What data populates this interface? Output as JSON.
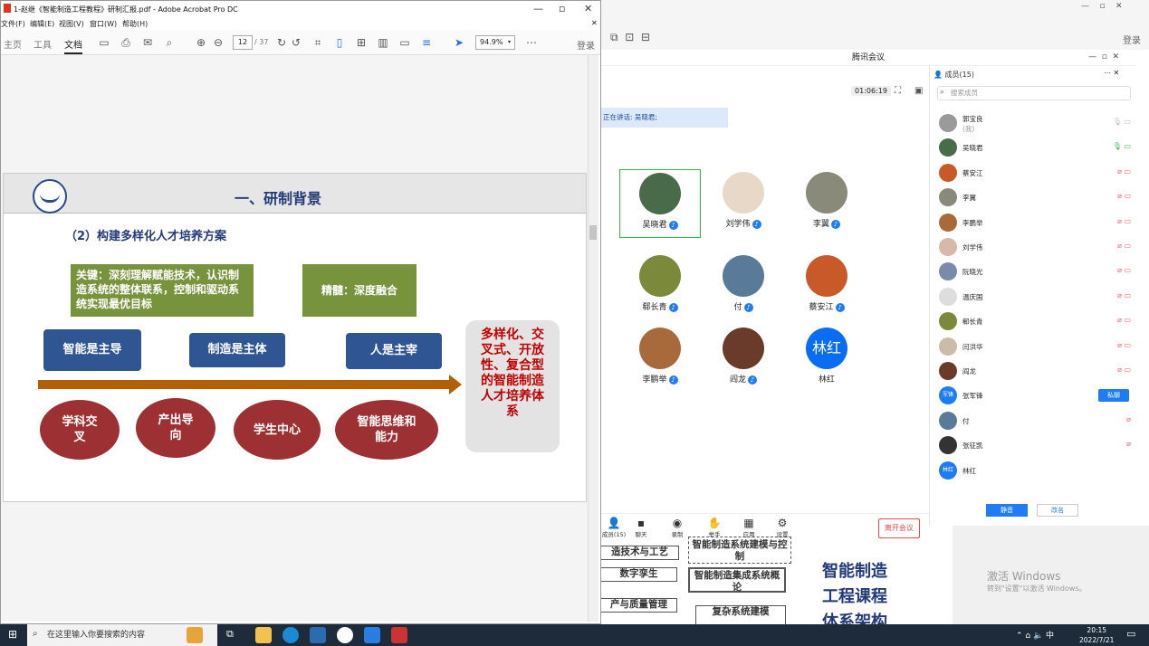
{
  "acrobat": {
    "title": "1-赵继《智能制造工程教程》研制汇报.pdf - Adobe Acrobat Pro DC",
    "menu": [
      "文件(F)",
      "编辑(E)",
      "视图(V)",
      "窗口(W)",
      "帮助(H)"
    ],
    "tabs": [
      "主页",
      "工具",
      "文档"
    ],
    "page_current": "12",
    "page_total": "/ 37",
    "zoom": "94.9%",
    "login": "登录"
  },
  "slide": {
    "heading": "一、研制背景",
    "subheading": "（2）构建多样化人才培养方案",
    "key_box": "关键：深刻理解赋能技术，认识制造系统的整体联系，控制和驱动系统实现最优目标",
    "essence_box": "精髓：深度融合",
    "blue_boxes": [
      "智能是主导",
      "制造是主体",
      "人是主宰"
    ],
    "ovals": [
      "学科交叉",
      "产出导向",
      "学生中心",
      "智能思维和能力"
    ],
    "result": "多样化、交叉式、开放性、复合型的智能制造人才培养体系"
  },
  "meeting": {
    "title": "腾讯会议",
    "timer": "01:06:19",
    "speaking": "正在讲话: 吴晓君;",
    "tiles": [
      {
        "name": "吴晓君",
        "color": "#4a6b4a"
      },
      {
        "name": "刘学伟",
        "color": "#e8d8c8"
      },
      {
        "name": "李翼",
        "color": "#8a8a7a"
      },
      {
        "name": "郗长青",
        "color": "#7a8a3a"
      },
      {
        "name": "付",
        "color": "#5a7a9a"
      },
      {
        "name": "蔡安江",
        "color": "#c85a2a"
      },
      {
        "name": "李鹏举",
        "color": "#a86a3a"
      },
      {
        "name": "阎龙",
        "color": "#6a3a2a"
      },
      {
        "name": "林红",
        "color": "#0a6cf2"
      }
    ],
    "toolbar": [
      "成员(15)",
      "聊天",
      "录制",
      "举手",
      "应用",
      "设置"
    ],
    "leave": "离开会议",
    "members_header": "成员(15)",
    "search_placeholder": "搜索成员",
    "members": [
      {
        "name": "郭宝良",
        "sub": "(我)",
        "color": "#9a9a9a"
      },
      {
        "name": "吴晓君",
        "color": "#4a6b4a"
      },
      {
        "name": "蔡安江",
        "color": "#c85a2a"
      },
      {
        "name": "李翼",
        "color": "#8a8a7a"
      },
      {
        "name": "李鹏举",
        "color": "#a86a3a"
      },
      {
        "name": "刘学伟",
        "color": "#d8b8a8"
      },
      {
        "name": "阮晓光",
        "color": "#7a8aaa"
      },
      {
        "name": "温庆国",
        "color": "#dddddd"
      },
      {
        "name": "郗长青",
        "color": "#7a8a3a"
      },
      {
        "name": "闫洪华",
        "color": "#cbbba8"
      },
      {
        "name": "阎龙",
        "color": "#6a3a2a"
      },
      {
        "name": "张军锋",
        "short": "军锋",
        "color": "#1e7df5"
      },
      {
        "name": "付",
        "color": "#5a7a9a"
      },
      {
        "name": "张征凯",
        "color": "#333333"
      },
      {
        "name": "林红",
        "short": "林红",
        "color": "#1e7df5"
      }
    ],
    "private_chat": "私聊",
    "mute_all": "静音",
    "rename": "改名"
  },
  "background": {
    "login": "登录",
    "boxes": [
      "造技术与工艺",
      "智能制造系统建模与控制",
      "数字孪生",
      "智能制造集成系统概论",
      "产与质量管理",
      "复杂系统建模"
    ],
    "big_text": [
      "智能制造",
      "工程课程",
      "体系架构"
    ]
  },
  "watermark": {
    "line1": "激活 Windows",
    "line2": "转到\"设置\"以激活 Windows。"
  },
  "taskbar": {
    "search": "在这里输入你要搜索的内容",
    "time": "20:15",
    "date": "2022/7/21",
    "ime": "中"
  }
}
